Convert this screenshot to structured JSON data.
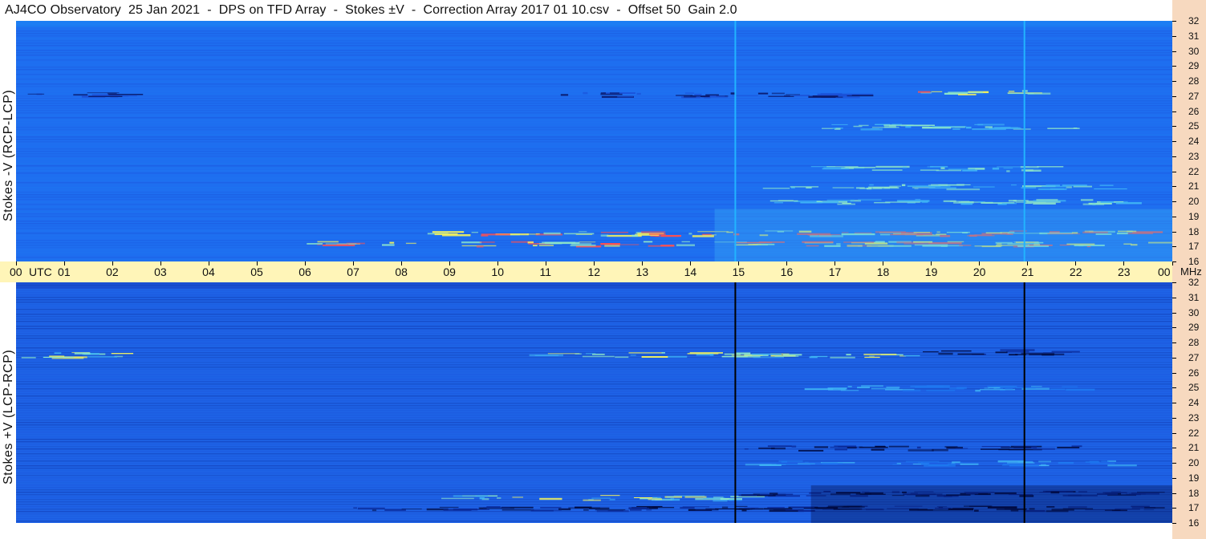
{
  "title": "AJ4CO Observatory  25 Jan 2021  -  DPS on TFD Array  -  Stokes ±V  -  Correction Array 2017 01 10.csv  -  Offset 50  Gain 2.0",
  "chart_data": [
    {
      "type": "heatmap",
      "name": "Stokes -V (RCP-LCP)",
      "ylabel": "Stokes -V (RCP-LCP)",
      "xlabel_unit": "UTC",
      "x_ticks": [
        "00",
        "01",
        "02",
        "03",
        "04",
        "05",
        "06",
        "07",
        "08",
        "09",
        "10",
        "11",
        "12",
        "13",
        "14",
        "15",
        "16",
        "17",
        "18",
        "19",
        "20",
        "21",
        "22",
        "23",
        "00"
      ],
      "xlim": [
        0,
        24
      ],
      "y_ticks": [
        32,
        31,
        30,
        29,
        28,
        27,
        26,
        25,
        24,
        23,
        22,
        21,
        20,
        19,
        18,
        17,
        16
      ],
      "ylabel_unit": "MHz",
      "ylim": [
        16,
        32
      ],
      "colormap": [
        "#0a1a6e",
        "#1a4fd6",
        "#1e78f0",
        "#3fb4f5",
        "#8fe8c8",
        "#f0f060",
        "#ff5050"
      ],
      "background_color": "#1e6ef0",
      "vertical_markers_utc": [
        14.93,
        20.93
      ],
      "marker_color": "#22b4ff",
      "features": [
        {
          "utc": [
            0.1,
            2.0
          ],
          "mhz": 27.1,
          "intensity": "low"
        },
        {
          "utc": [
            11.3,
            15.0
          ],
          "mhz": 27.1,
          "intensity": "low"
        },
        {
          "utc": [
            15.0,
            17.5
          ],
          "mhz": 27.1,
          "intensity": "low"
        },
        {
          "utc": [
            18.5,
            21.0
          ],
          "mhz": 27.3,
          "intensity": "high"
        },
        {
          "utc": [
            6.0,
            23.5
          ],
          "mhz": 17.2,
          "intensity": "high"
        },
        {
          "utc": [
            8.5,
            23.5
          ],
          "mhz": 17.9,
          "intensity": "high"
        },
        {
          "utc": [
            15.0,
            23.0
          ],
          "mhz": 20.0,
          "intensity": "medium"
        },
        {
          "utc": [
            15.5,
            22.5
          ],
          "mhz": 21.0,
          "intensity": "medium"
        },
        {
          "utc": [
            16.0,
            22.0
          ],
          "mhz": 25.0,
          "intensity": "medium"
        },
        {
          "utc": [
            16.5,
            21.5
          ],
          "mhz": 22.2,
          "intensity": "medium"
        }
      ]
    },
    {
      "type": "heatmap",
      "name": "Stokes +V (LCP-RCP)",
      "ylabel": "Stokes +V (LCP-RCP)",
      "xlabel_unit": "UTC",
      "xlim": [
        0,
        24
      ],
      "y_ticks": [
        32,
        31,
        30,
        29,
        28,
        27,
        26,
        25,
        24,
        23,
        22,
        21,
        20,
        19,
        18,
        17,
        16
      ],
      "ylabel_unit": "MHz",
      "ylim": [
        16,
        32
      ],
      "colormap": [
        "#000a40",
        "#0a2a9a",
        "#1a4fd6",
        "#1e78f0",
        "#3fb4f5",
        "#8fe8c8",
        "#f0f060"
      ],
      "background_color": "#1e63e6",
      "vertical_markers_utc": [
        14.93,
        20.93
      ],
      "marker_color": "#000000",
      "features": [
        {
          "utc": [
            0.0,
            2.2
          ],
          "mhz": 27.2,
          "intensity": "high"
        },
        {
          "utc": [
            10.5,
            18.5
          ],
          "mhz": 27.2,
          "intensity": "high"
        },
        {
          "utc": [
            18.5,
            21.5
          ],
          "mhz": 27.4,
          "intensity": "low"
        },
        {
          "utc": [
            8.5,
            15.0
          ],
          "mhz": 17.7,
          "intensity": "high"
        },
        {
          "utc": [
            7.0,
            23.5
          ],
          "mhz": 17.0,
          "intensity": "low"
        },
        {
          "utc": [
            14.5,
            23.5
          ],
          "mhz": 18.0,
          "intensity": "low"
        },
        {
          "utc": [
            15.0,
            23.0
          ],
          "mhz": 20.0,
          "intensity": "medium"
        },
        {
          "utc": [
            16.0,
            22.0
          ],
          "mhz": 25.0,
          "intensity": "medium"
        },
        {
          "utc": [
            15.0,
            22.0
          ],
          "mhz": 21.0,
          "intensity": "low"
        }
      ]
    }
  ],
  "labels": {
    "utc": "UTC",
    "mhz": "MHz",
    "top_ylabel": "Stokes -V (RCP-LCP)",
    "bottom_ylabel": "Stokes +V (LCP-RCP)"
  }
}
